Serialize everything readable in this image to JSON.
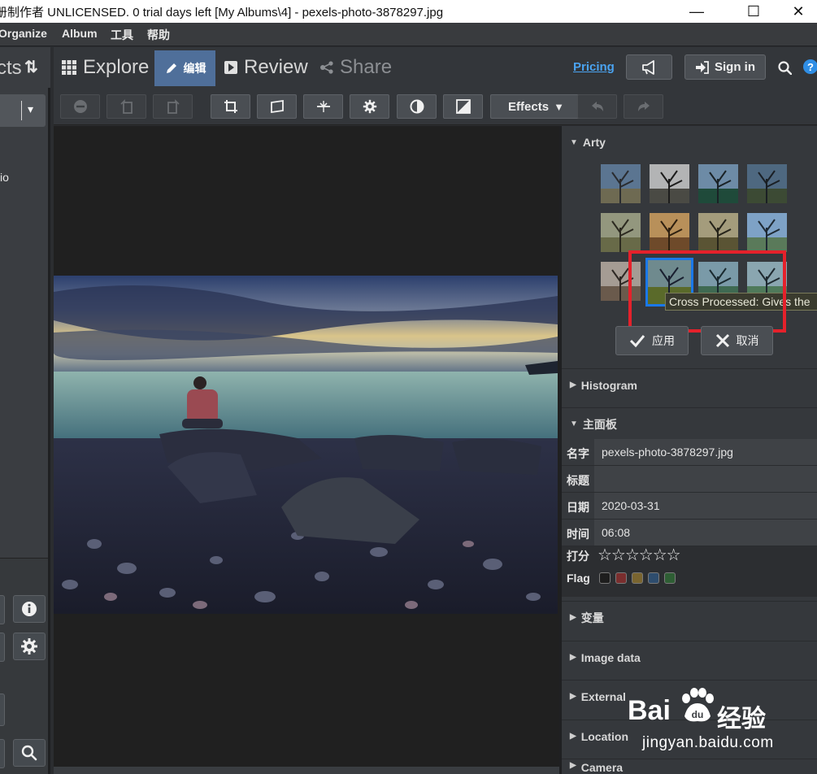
{
  "window": {
    "title": "册制作者 UNLICENSED. 0 trial days left [My Albums\\4] - pexels-photo-3878297.jpg",
    "minimize": "—",
    "maximize": "☐",
    "close": "✕"
  },
  "menu": [
    "Organize",
    "Album",
    "工具",
    "帮助"
  ],
  "left_panel": {
    "title": "cts",
    "sort_glyph": "⇅",
    "dropdown_chevron": "▾",
    "partial_text": "io"
  },
  "nav": {
    "explore": "Explore",
    "edit": "编辑",
    "review": "Review",
    "share": "Share",
    "pricing": "Pricing",
    "sign_in": "Sign in",
    "help": "?"
  },
  "toolbar": {
    "effects": "Effects"
  },
  "right_panel": {
    "arty_section": "Arty",
    "tooltip": "Cross Processed: Gives the",
    "apply": "应用",
    "cancel": "取消",
    "histogram_section": "Histogram",
    "main_section": "主面板",
    "properties": [
      {
        "label": "名字",
        "value": "pexels-photo-3878297.jpg"
      },
      {
        "label": "标题",
        "value": ""
      },
      {
        "label": "日期",
        "value": "2020-03-31"
      },
      {
        "label": "时间",
        "value": "06:08"
      }
    ],
    "rating_label": "打分",
    "rating_stars": "☆☆☆☆☆☆",
    "rating_value": 0,
    "flag_label": "Flag",
    "flag_colors": [
      "#1e1e1e",
      "#7a2e2e",
      "#7a6530",
      "#2e4d6e",
      "#2e5e34"
    ],
    "variables_section": "变量",
    "image_data_section": "Image data",
    "external_section": "External",
    "location_section": "Location",
    "camera_section": "Camera"
  },
  "watermark": {
    "brand_left": "Bai",
    "brand_right": "经验",
    "url": "jingyan.baidu.com"
  },
  "colors": {
    "accent_blue": "#4aa3f0",
    "selection_blue": "#1a78e8",
    "annotation_red": "#e5212b",
    "edit_tab": "#4f6f9a"
  }
}
